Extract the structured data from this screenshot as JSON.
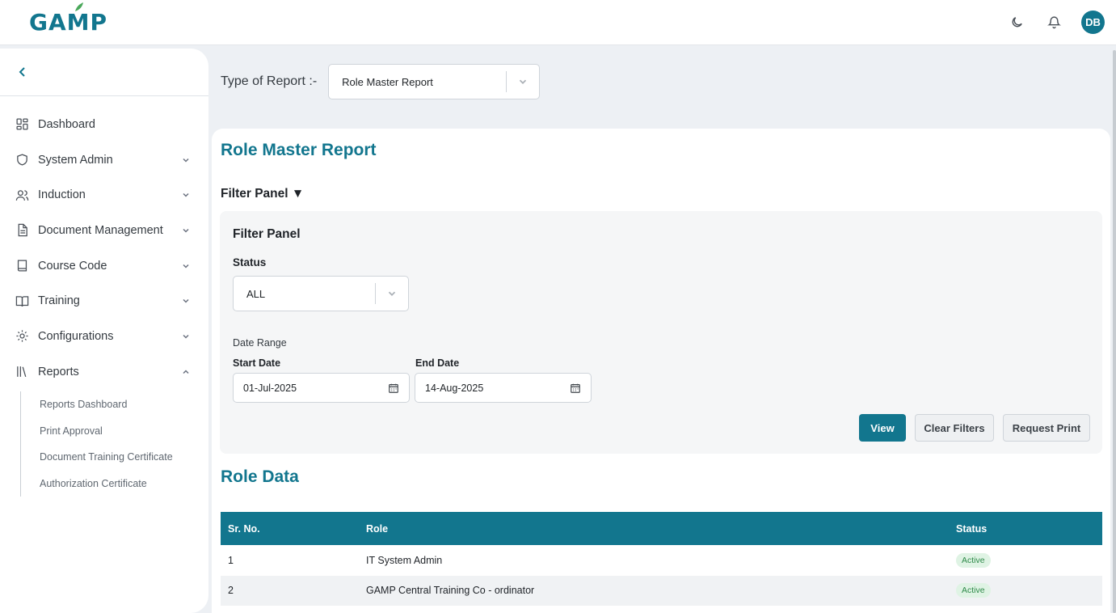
{
  "header": {
    "logo_text_part1": "GAM",
    "logo_text_part2": "P",
    "avatar_initials": "DB"
  },
  "sidebar": {
    "items": [
      {
        "label": "Dashboard",
        "icon": "dashboard-icon"
      },
      {
        "label": "System Admin",
        "icon": "shield-icon"
      },
      {
        "label": "Induction",
        "icon": "users-icon"
      },
      {
        "label": "Document Management",
        "icon": "document-icon"
      },
      {
        "label": "Course Code",
        "icon": "book-icon"
      },
      {
        "label": "Training",
        "icon": "open-book-icon"
      },
      {
        "label": "Configurations",
        "icon": "gear-icon"
      },
      {
        "label": "Reports",
        "icon": "library-icon"
      }
    ],
    "reports_sub": [
      "Reports Dashboard",
      "Print Approval",
      "Document Training Certificate",
      "Authorization Certificate"
    ]
  },
  "report_type": {
    "label": "Type of Report :-",
    "selected": "Role Master Report"
  },
  "card": {
    "title": "Role Master Report",
    "filter_toggle": "Filter Panel ▼",
    "filter_title": "Filter Panel",
    "status_label": "Status",
    "status_value": "ALL",
    "date_range_label": "Date Range",
    "start_label": "Start Date",
    "start_value": "01-Jul-2025",
    "end_label": "End Date",
    "end_value": "14-Aug-2025",
    "view_btn": "View",
    "clear_btn": "Clear Filters",
    "print_btn": "Request Print"
  },
  "role_data": {
    "title": "Role Data",
    "columns": [
      "Sr. No.",
      "Role",
      "Status"
    ],
    "rows": [
      {
        "sr": "1",
        "role": "IT System Admin",
        "status": "Active"
      },
      {
        "sr": "2",
        "role": "GAMP Central Training Co - ordinator",
        "status": "Active"
      }
    ]
  },
  "colors": {
    "accent": "#12768e",
    "active_badge_bg": "#dff3e4",
    "active_badge_text": "#2f8a4a"
  }
}
